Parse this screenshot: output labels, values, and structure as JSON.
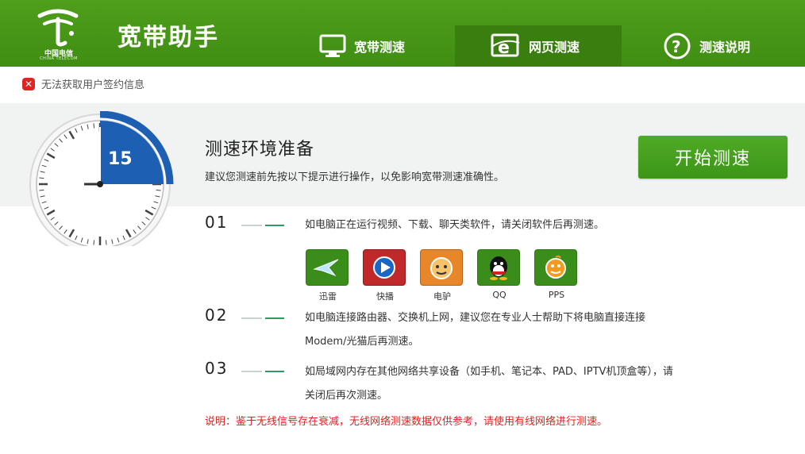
{
  "header": {
    "logo_text": "中国电信",
    "logo_sub": "CHINA TELECOM",
    "app_title": "宽带助手",
    "tabs": [
      {
        "label": "宽带测速",
        "icon": "monitor-icon",
        "active": false
      },
      {
        "label": "网页测速",
        "icon": "browser-e-icon",
        "active": true
      },
      {
        "label": "测速说明",
        "icon": "question-icon",
        "active": false
      }
    ]
  },
  "status": {
    "error_text": "无法获取用户签约信息",
    "icon": "error-x-icon"
  },
  "timer": {
    "value": "15",
    "progress_fraction": 0.25
  },
  "prep": {
    "title": "测速环境准备",
    "description": "建议您测速前先按以下提示进行操作，以免影响宽带测速准确性。",
    "start_button": "开始测速"
  },
  "steps": [
    {
      "number": "01",
      "text": "如电脑正在运行视频、下载、聊天类软件，请关闭软件后再测速。"
    },
    {
      "number": "02",
      "text_line1": "如电脑连接路由器、交换机上网，建议您在专业人士帮助下将电脑直接连接",
      "text_line2": "Modem/光猫后再测速。"
    },
    {
      "number": "03",
      "text_line1": "如局域网内存在其他网络共享设备（如手机、笔记本、PAD、IPTV机顶盒等），请",
      "text_line2": "关闭后再次测速。"
    }
  ],
  "apps": [
    {
      "name": "迅雷",
      "icon": "xunlei-icon"
    },
    {
      "name": "快播",
      "icon": "kuaibo-icon"
    },
    {
      "name": "电驴",
      "icon": "edonkey-icon"
    },
    {
      "name": "QQ",
      "icon": "qq-icon"
    },
    {
      "name": "PPS",
      "icon": "pps-icon"
    }
  ],
  "note": "说明：鉴于无线信号存在衰减，无线网络测速数据仅供参考，请使用有线网络进行测速。",
  "colors": {
    "header_green": "#4f9e1c",
    "button_green": "#45a01e",
    "timer_blue": "#1d5fb3",
    "note_red": "#e02020"
  }
}
